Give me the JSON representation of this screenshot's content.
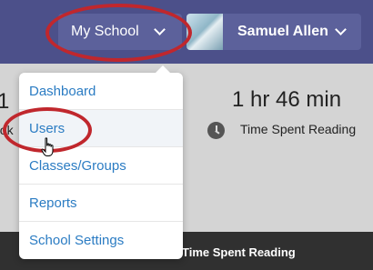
{
  "header": {
    "school_button": "My School",
    "user_button": "Samuel Allen"
  },
  "menu": {
    "items": [
      {
        "label": "Dashboard"
      },
      {
        "label": "Users"
      },
      {
        "label": "Classes/Groups"
      },
      {
        "label": "Reports"
      },
      {
        "label": "School Settings"
      }
    ]
  },
  "stats": {
    "left_value_partial": "1",
    "left_label_partial": "ook",
    "time_value": "1 hr 46 min",
    "time_label": "Time Spent Reading"
  },
  "table_header": {
    "col_time": "Time Spent Reading"
  },
  "icons": {
    "chevron": "chevron-down-icon",
    "clock": "clock-icon",
    "pointer": "hand-pointer-icon"
  },
  "colors": {
    "topbar": "#4c508a",
    "button": "#5c619b",
    "link": "#2b7cc3",
    "annotation_ring": "#c0272d"
  }
}
